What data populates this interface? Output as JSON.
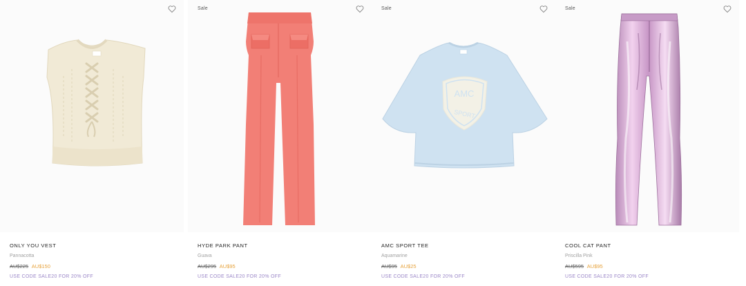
{
  "products": [
    {
      "sale_tag": "",
      "name": "ONLY YOU VEST",
      "color": "Pannacotta",
      "old_price": "AU$225",
      "new_price": "AU$150",
      "promo": "USE CODE SALE20 FOR 20% OFF",
      "image_icon": "knit-vest-image",
      "image_color": "#f1ead6"
    },
    {
      "sale_tag": "Sale",
      "name": "HYDE PARK PANT",
      "color": "Guava",
      "old_price": "AU$295",
      "new_price": "AU$95",
      "promo": "USE CODE SALE20 FOR 20% OFF",
      "image_icon": "wide-leg-pant-image",
      "image_color": "#f27f76"
    },
    {
      "sale_tag": "Sale",
      "name": "AMC SPORT TEE",
      "color": "Aquamarine",
      "old_price": "AU$95",
      "new_price": "AU$25",
      "promo": "USE CODE SALE20 FOR 20% OFF",
      "image_icon": "cropped-tee-image",
      "image_color": "#cfe2f1",
      "tee_text_top": "AMC",
      "tee_text_bottom": "SPORT"
    },
    {
      "sale_tag": "Sale",
      "name": "COOL CAT PANT",
      "color": "Priscilla Pink",
      "old_price": "AU$595",
      "new_price": "AU$95",
      "promo": "USE CODE SALE20 FOR 20% OFF",
      "image_icon": "metallic-pant-image",
      "image_color": "#d9a9d6"
    }
  ],
  "colors": {
    "sale_price": "#e6a23c",
    "promo": "#9a86c7",
    "secondary_text": "#a0a0a0"
  }
}
